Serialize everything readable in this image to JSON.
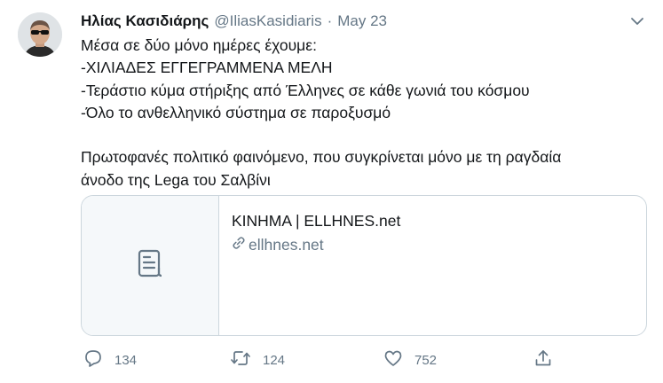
{
  "tweet": {
    "author_name": "Ηλίας Κασιδιάρης",
    "handle": "@IliasKasidiaris",
    "separator": "·",
    "date": "May 23",
    "lines": [
      "Μέσα σε δύο μόνο ημέρες έχουμε:",
      "-ΧΙΛΙΑΔΕΣ ΕΓΓΕΓΡΑΜΜΕΝΑ ΜΕΛΗ",
      "-Τεράστιο κύμα στήριξης από Έλληνες σε κάθε γωνιά του κόσμου",
      "-Όλο το ανθελληνικό σύστημα σε παροξυσμό",
      "",
      "Πρωτοφανές πολιτικό φαινόμενο, που συγκρίνεται μόνο με τη ραγδαία",
      "άνοδο της Lega του Σαλβίνι"
    ]
  },
  "card": {
    "title": "ΚΙΝΗΜΑ | ELLHNES.net",
    "domain": "ellhnes.net",
    "thumb_icon": "document-icon",
    "domain_icon": "link-icon"
  },
  "actions": {
    "reply": {
      "icon": "reply-icon",
      "count": "134"
    },
    "retweet": {
      "icon": "retweet-icon",
      "count": "124"
    },
    "like": {
      "icon": "heart-icon",
      "count": "752"
    },
    "share": {
      "icon": "share-icon"
    }
  },
  "colors": {
    "text": "#14171a",
    "secondary": "#657786",
    "border": "#ccd6dd",
    "card_thumb_bg": "#f5f8fa"
  }
}
